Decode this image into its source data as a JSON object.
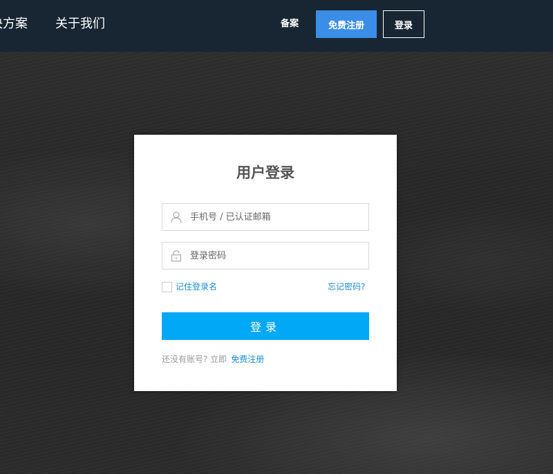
{
  "header": {
    "nav": [
      {
        "label": "决方案"
      },
      {
        "label": "关于我们"
      }
    ],
    "beian_label": "备案",
    "register_label": "免费注册",
    "login_label": "登录",
    "colors": {
      "bar": "#182633",
      "register_button": "#3a8ee6"
    }
  },
  "login_card": {
    "title": "用户登录",
    "username_placeholder": "手机号 / 已认证邮箱",
    "username_icon": "user-icon",
    "password_placeholder": "登录密码",
    "password_icon": "lock-icon",
    "remember_label": "记住登录名",
    "remember_checked": false,
    "forgot_label": "忘记密码?",
    "submit_label": "登录",
    "signup_prompt": "还没有账号? 立即",
    "signup_link": "免费注册",
    "colors": {
      "submit_button": "#00a8f5",
      "link": "#1b8fd6"
    }
  }
}
